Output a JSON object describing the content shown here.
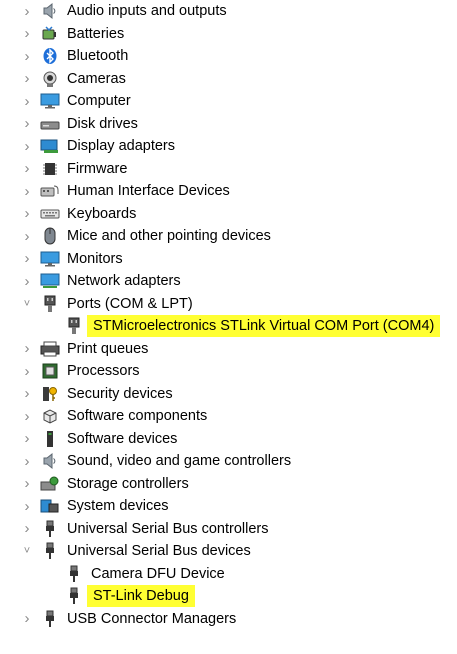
{
  "tree": {
    "items": [
      {
        "label": "Audio inputs and outputs",
        "icon": "speaker-icon",
        "state": "collapsed",
        "level": 0
      },
      {
        "label": "Batteries",
        "icon": "battery-icon",
        "state": "collapsed",
        "level": 0
      },
      {
        "label": "Bluetooth",
        "icon": "bluetooth-icon",
        "state": "collapsed",
        "level": 0
      },
      {
        "label": "Cameras",
        "icon": "camera-icon",
        "state": "collapsed",
        "level": 0
      },
      {
        "label": "Computer",
        "icon": "monitor-icon",
        "state": "collapsed",
        "level": 0
      },
      {
        "label": "Disk drives",
        "icon": "disk-drive-icon",
        "state": "collapsed",
        "level": 0
      },
      {
        "label": "Display adapters",
        "icon": "display-adapter-icon",
        "state": "collapsed",
        "level": 0
      },
      {
        "label": "Firmware",
        "icon": "firmware-chip-icon",
        "state": "collapsed",
        "level": 0
      },
      {
        "label": "Human Interface Devices",
        "icon": "hid-icon",
        "state": "collapsed",
        "level": 0
      },
      {
        "label": "Keyboards",
        "icon": "keyboard-icon",
        "state": "collapsed",
        "level": 0
      },
      {
        "label": "Mice and other pointing devices",
        "icon": "mouse-icon",
        "state": "collapsed",
        "level": 0
      },
      {
        "label": "Monitors",
        "icon": "monitor-icon",
        "state": "collapsed",
        "level": 0
      },
      {
        "label": "Network adapters",
        "icon": "network-adapter-icon",
        "state": "collapsed",
        "level": 0
      },
      {
        "label": "Ports (COM & LPT)",
        "icon": "port-connector-icon",
        "state": "expanded",
        "level": 0
      },
      {
        "label": "STMicroelectronics STLink Virtual COM Port (COM4)",
        "icon": "port-connector-icon",
        "state": "leaf",
        "level": 1,
        "highlighted": true
      },
      {
        "label": "Print queues",
        "icon": "printer-icon",
        "state": "collapsed",
        "level": 0
      },
      {
        "label": "Processors",
        "icon": "processor-icon",
        "state": "collapsed",
        "level": 0
      },
      {
        "label": "Security devices",
        "icon": "security-key-icon",
        "state": "collapsed",
        "level": 0
      },
      {
        "label": "Software components",
        "icon": "software-component-icon",
        "state": "collapsed",
        "level": 0
      },
      {
        "label": "Software devices",
        "icon": "software-device-icon",
        "state": "collapsed",
        "level": 0
      },
      {
        "label": "Sound, video and game controllers",
        "icon": "speaker-icon",
        "state": "collapsed",
        "level": 0
      },
      {
        "label": "Storage controllers",
        "icon": "storage-controller-icon",
        "state": "collapsed",
        "level": 0
      },
      {
        "label": "System devices",
        "icon": "system-folder-icon",
        "state": "collapsed",
        "level": 0
      },
      {
        "label": "Universal Serial Bus controllers",
        "icon": "usb-plug-icon",
        "state": "collapsed",
        "level": 0
      },
      {
        "label": "Universal Serial Bus devices",
        "icon": "usb-plug-icon",
        "state": "expanded",
        "level": 0
      },
      {
        "label": "Camera DFU Device",
        "icon": "usb-plug-icon",
        "state": "leaf",
        "level": 1
      },
      {
        "label": "ST-Link Debug",
        "icon": "usb-plug-icon",
        "state": "leaf",
        "level": 1,
        "highlighted": true
      },
      {
        "label": "USB Connector Managers",
        "icon": "usb-plug-icon",
        "state": "collapsed",
        "level": 0
      }
    ]
  },
  "colors": {
    "highlight": "#ffff33",
    "chevron": "#8a8a8a",
    "text": "#000000"
  }
}
